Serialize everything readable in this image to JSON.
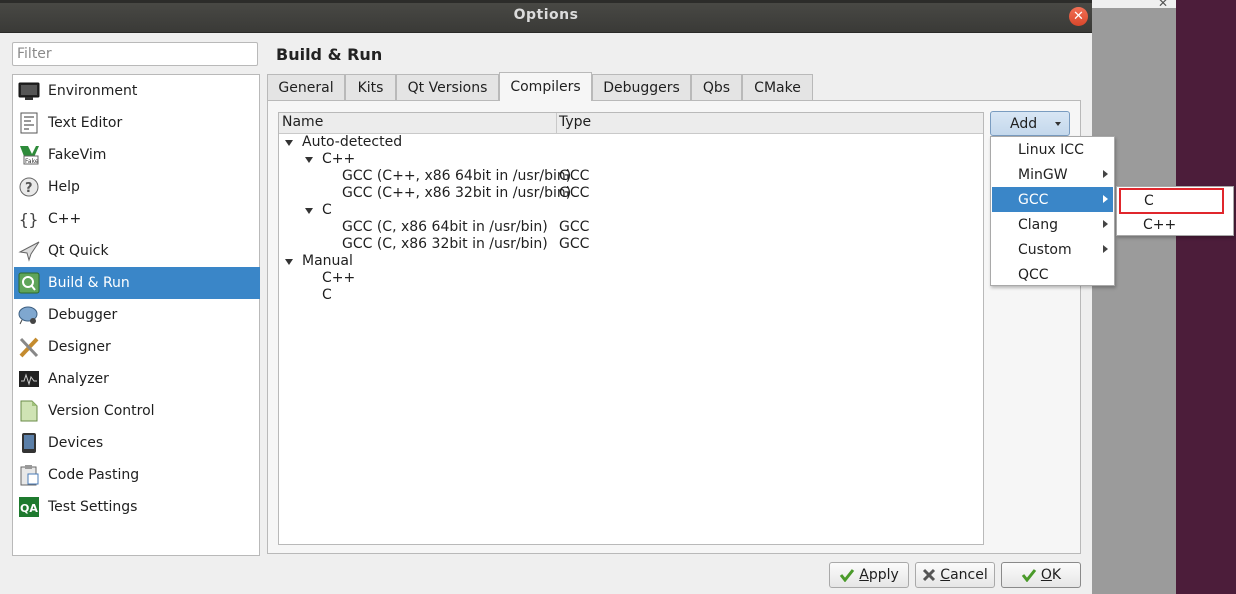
{
  "window": {
    "title": "Options"
  },
  "filter": {
    "placeholder": "Filter"
  },
  "sidebar": {
    "items": [
      {
        "label": "Environment",
        "icon": "monitor-icon"
      },
      {
        "label": "Text Editor",
        "icon": "text-editor-icon"
      },
      {
        "label": "FakeVim",
        "icon": "fakevim-icon"
      },
      {
        "label": "Help",
        "icon": "help-icon"
      },
      {
        "label": "C++",
        "icon": "braces-icon"
      },
      {
        "label": "Qt Quick",
        "icon": "paper-plane-icon"
      },
      {
        "label": "Build & Run",
        "icon": "qt-build-icon",
        "selected": true
      },
      {
        "label": "Debugger",
        "icon": "bug-icon"
      },
      {
        "label": "Designer",
        "icon": "pencil-ruler-icon"
      },
      {
        "label": "Analyzer",
        "icon": "oscilloscope-icon"
      },
      {
        "label": "Version Control",
        "icon": "document-icon"
      },
      {
        "label": "Devices",
        "icon": "phone-icon"
      },
      {
        "label": "Code Pasting",
        "icon": "clipboard-icon"
      },
      {
        "label": "Test Settings",
        "icon": "qa-icon"
      }
    ]
  },
  "page": {
    "title": "Build & Run"
  },
  "tabs": [
    "General",
    "Kits",
    "Qt Versions",
    "Compilers",
    "Debuggers",
    "Qbs",
    "CMake"
  ],
  "active_tab": "Compilers",
  "tree": {
    "columns": [
      "Name",
      "Type"
    ],
    "auto_detected": "Auto-detected",
    "cpp_group": "C++",
    "c_group": "C",
    "manual": "Manual",
    "manual_cpp": "C++",
    "manual_c": "C",
    "compilers": [
      {
        "name": "GCC (C++, x86 64bit in /usr/bin)",
        "type": "GCC"
      },
      {
        "name": "GCC (C++, x86 32bit in /usr/bin)",
        "type": "GCC"
      },
      {
        "name": "GCC (C, x86 64bit in /usr/bin)",
        "type": "GCC"
      },
      {
        "name": "GCC (C, x86 32bit in /usr/bin)",
        "type": "GCC"
      }
    ]
  },
  "add_button": {
    "label": "Add"
  },
  "add_menu": {
    "items": [
      {
        "label": "Linux ICC",
        "submenu": false
      },
      {
        "label": "MinGW",
        "submenu": true
      },
      {
        "label": "GCC",
        "submenu": true,
        "highlighted": true
      },
      {
        "label": "Clang",
        "submenu": true
      },
      {
        "label": "Custom",
        "submenu": true
      },
      {
        "label": "QCC",
        "submenu": false
      }
    ]
  },
  "gcc_submenu": {
    "items": [
      {
        "label": "C",
        "outlined": true
      },
      {
        "label": "C++"
      }
    ]
  },
  "buttons": {
    "apply": {
      "prefix": "A",
      "rest": "pply"
    },
    "cancel": {
      "prefix": "C",
      "rest": "ancel"
    },
    "ok": {
      "prefix": "O",
      "rest": "K"
    }
  },
  "colors": {
    "selection": "#3a86c8",
    "highlight_box": "#e0262c"
  }
}
